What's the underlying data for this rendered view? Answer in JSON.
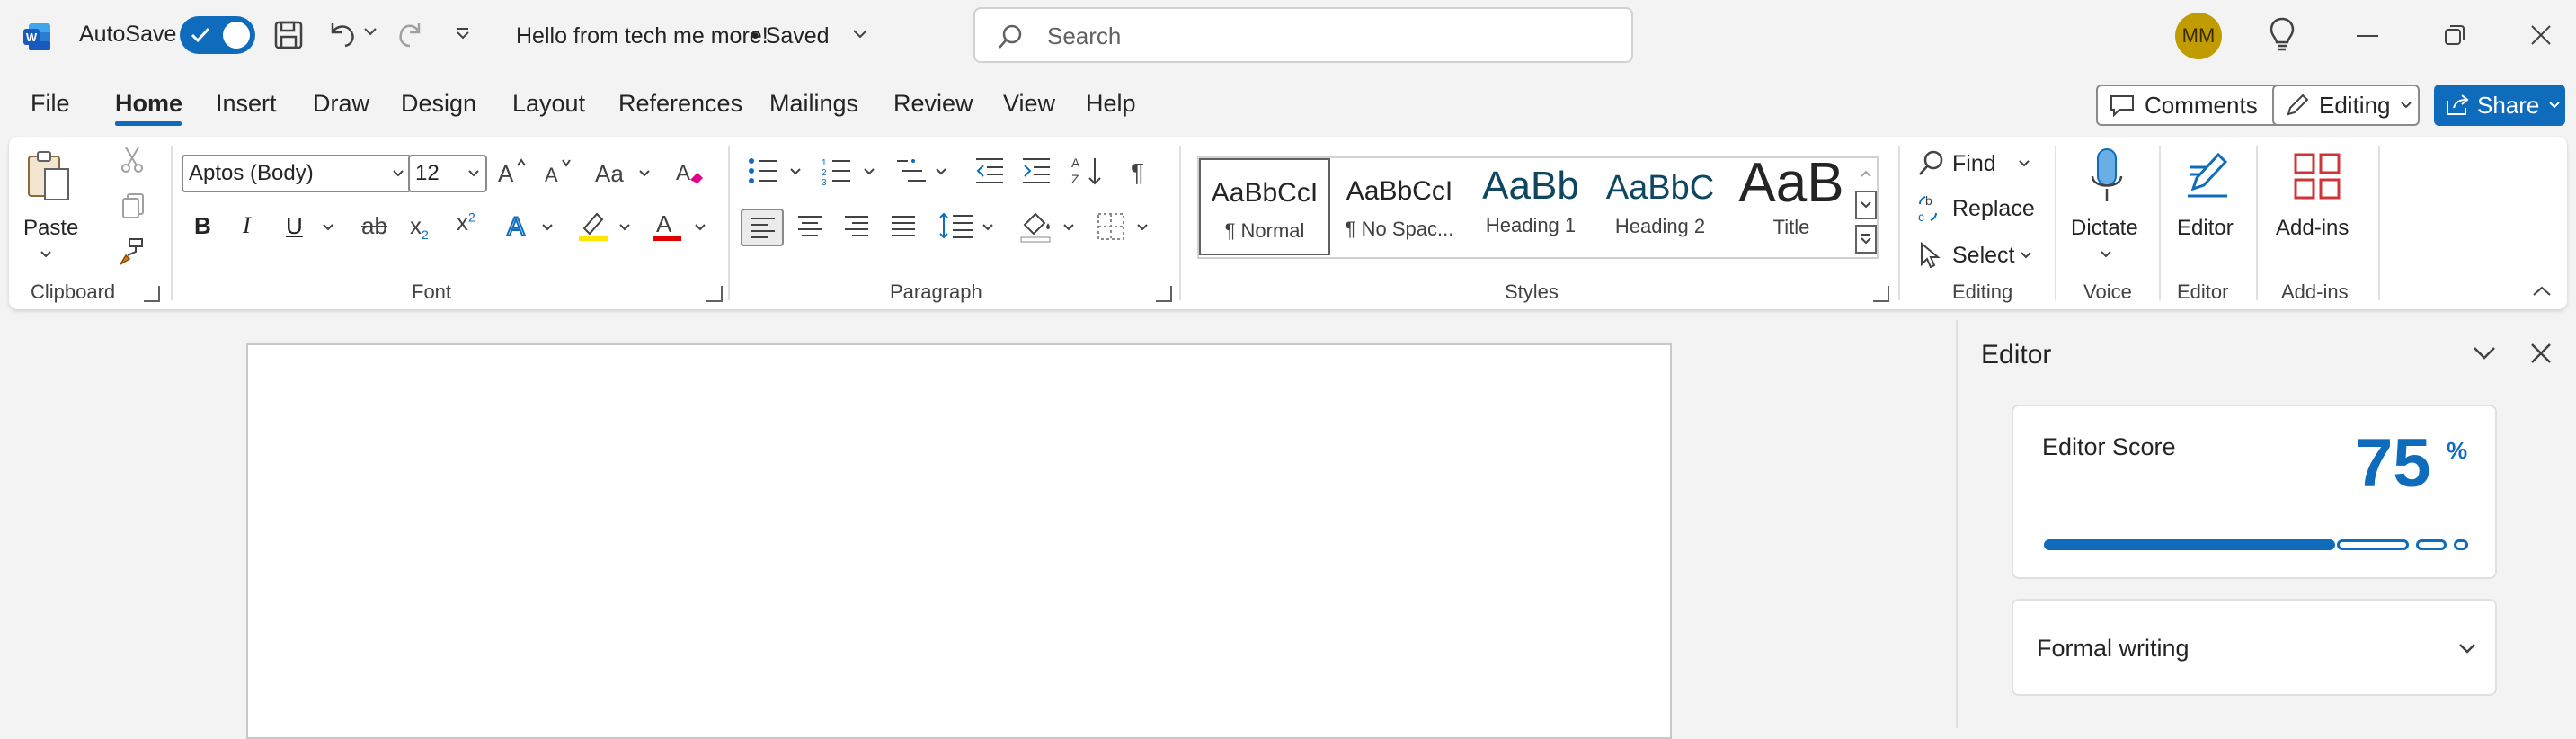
{
  "titlebar": {
    "autosave_label": "AutoSave",
    "autosave_on": true,
    "doc_title": "Hello from tech me more!",
    "save_state": "• Saved",
    "search_placeholder": "Search",
    "user_initials": "MM"
  },
  "menu": {
    "tabs": [
      {
        "label": "File"
      },
      {
        "label": "Home",
        "active": true
      },
      {
        "label": "Insert"
      },
      {
        "label": "Draw"
      },
      {
        "label": "Design"
      },
      {
        "label": "Layout"
      },
      {
        "label": "References"
      },
      {
        "label": "Mailings"
      },
      {
        "label": "Review"
      },
      {
        "label": "View"
      },
      {
        "label": "Help"
      }
    ],
    "comments_label": "Comments",
    "editing_label": "Editing",
    "share_label": "Share"
  },
  "ribbon": {
    "clipboard": {
      "paste_label": "Paste",
      "group_label": "Clipboard"
    },
    "font": {
      "font_name": "Aptos (Body)",
      "font_size": "12",
      "group_label": "Font",
      "change_case": "Aa"
    },
    "paragraph": {
      "group_label": "Paragraph"
    },
    "styles": {
      "group_label": "Styles",
      "items": [
        {
          "sample": "AaBbCcI",
          "name": "¶ Normal"
        },
        {
          "sample": "AaBbCcI",
          "name": "¶ No Spac..."
        },
        {
          "sample": "AaBb",
          "name": "Heading 1"
        },
        {
          "sample": "AaBbC",
          "name": "Heading 2"
        },
        {
          "sample": "AaB",
          "name": "Title"
        }
      ]
    },
    "editing": {
      "find": "Find",
      "replace": "Replace",
      "select": "Select",
      "group_label": "Editing"
    },
    "voice": {
      "dictate": "Dictate",
      "group_label": "Voice"
    },
    "editor": {
      "label": "Editor",
      "group_label": "Editor"
    },
    "addins": {
      "label": "Add-ins",
      "group_label": "Add-ins"
    }
  },
  "editor_pane": {
    "title": "Editor",
    "score_label": "Editor Score",
    "score_value": "75",
    "score_unit": "%",
    "score_fraction": 0.75,
    "mode_label": "Formal writing"
  },
  "colors": {
    "accent": "#0f6cbd",
    "highlight": "#ffe600",
    "font_color": "#e00000",
    "addins_red": "#d13438"
  }
}
